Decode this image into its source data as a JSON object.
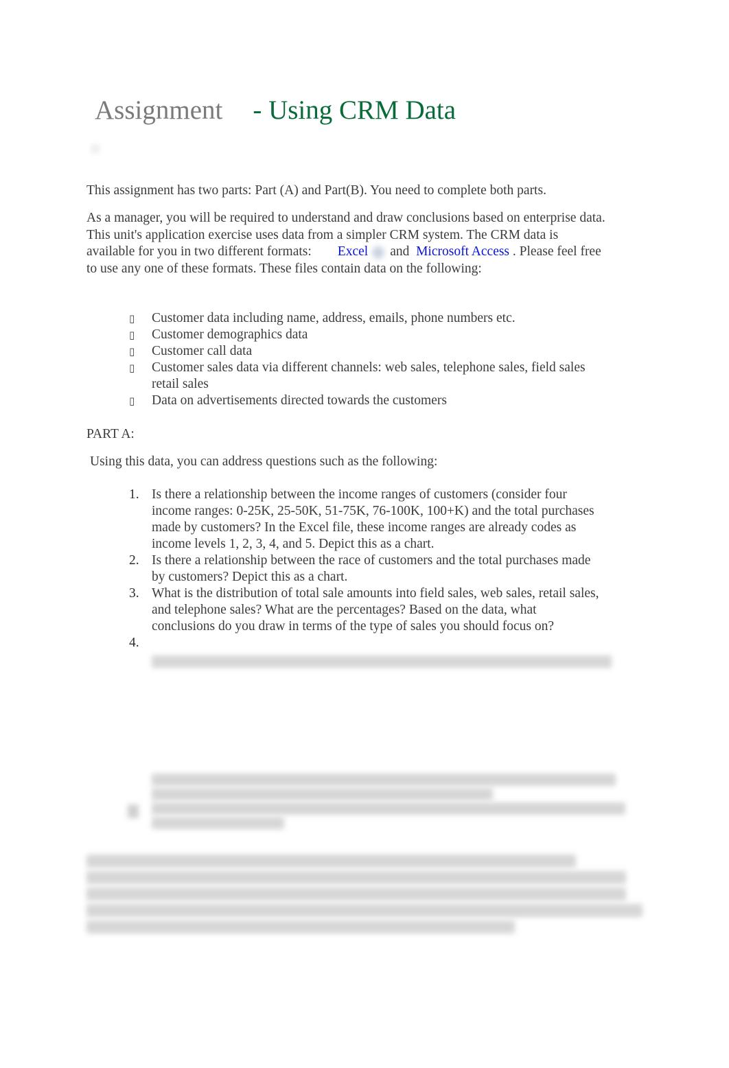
{
  "document": {
    "title_prefix": "Assignment",
    "title_main": "- Using CRM Data",
    "intro_paragraph": "This assignment has two parts: Part (A) and Part(B). You need to complete both parts.",
    "context_paragraph": {
      "text_before": "As a manager, you will be required to understand and draw conclusions based on enterprise data. This unit's application exercise uses data from a simpler CRM system. The CRM data is available for you in two different formats:",
      "link_excel": "Excel",
      "connector": "and",
      "link_access": "Microsoft Access",
      "text_after": ". Please feel free to use any one of these formats. These files contain data on the following:"
    },
    "bullet_glyph": "",
    "data_items": [
      "Customer data including name, address, emails, phone numbers etc.",
      "Customer demographics data",
      "Customer call data",
      "Customer sales data via different channels: web sales, telephone sales, field sales retail sales",
      "Data on advertisements directed towards the customers"
    ],
    "part_a_heading": "PART A:",
    "part_a_intro": "Using this data, you can address questions such as the following:",
    "questions": [
      {
        "num": "1.",
        "text": "Is there a relationship between the income ranges of customers (consider four income ranges: 0-25K, 25-50K, 51-75K, 76-100K, 100+K) and the total purchases made by customers? In the Excel file, these income ranges are already codes as income levels 1, 2, 3, 4, and 5. Depict this as a chart."
      },
      {
        "num": "2.",
        "text": "Is there a relationship between the race of customers and the total purchases made by customers? Depict this as a chart."
      },
      {
        "num": "3.",
        "text": "What is the distribution of total sale amounts into field sales, web sales, retail sales, and telephone sales? What are the percentages? Based on the data, what conclusions do you draw in terms of the type of sales you should focus on?"
      },
      {
        "num": "4.",
        "text": ""
      }
    ]
  }
}
